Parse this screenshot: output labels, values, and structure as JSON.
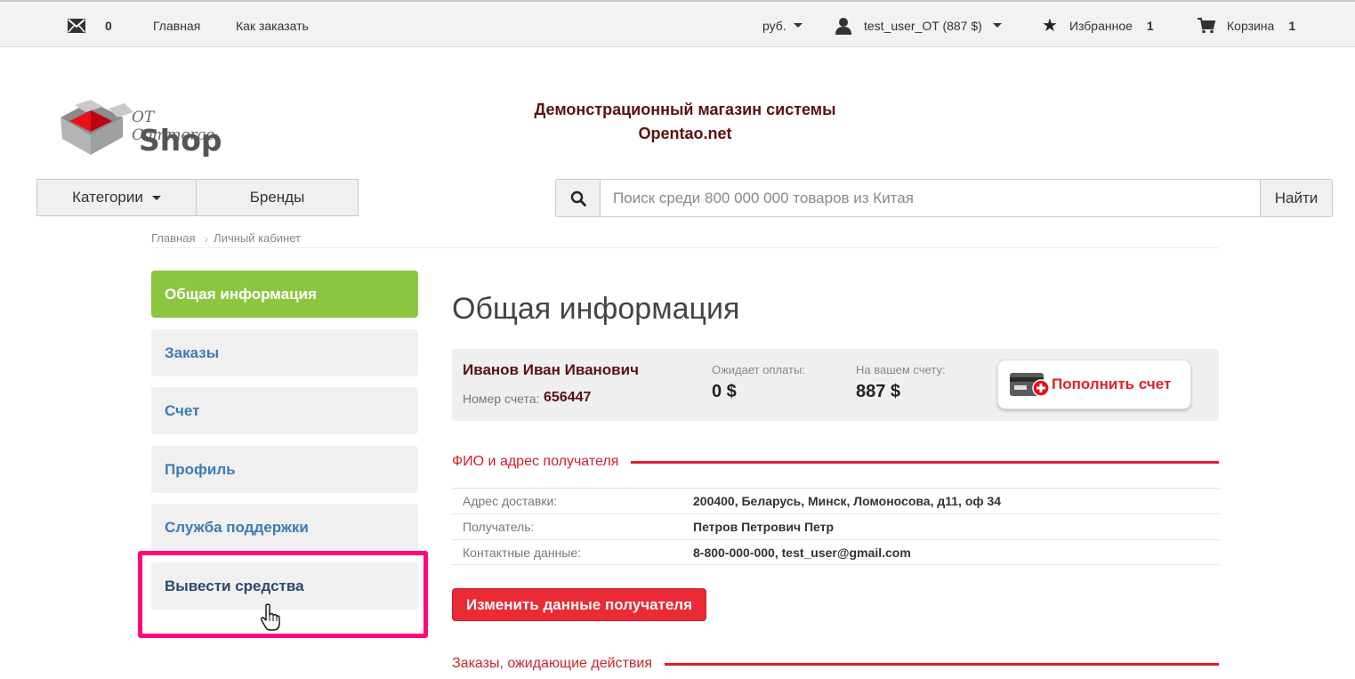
{
  "topbar": {
    "mail_icon": "envelope-icon",
    "mail_count": "0",
    "nav_home": "Главная",
    "nav_how_to_order": "Как заказать",
    "currency": "руб.",
    "user_icon": "user-icon",
    "user_label": "test_user_OT (887 $)",
    "favorites_icon": "star-icon",
    "favorites_label": "Избранное",
    "favorites_count": "1",
    "cart_icon": "cart-icon",
    "cart_label": "Корзина",
    "cart_count": "1"
  },
  "header": {
    "logo_text_top": "OT Commerce",
    "logo_text_main": "Shop",
    "title_line1": "Демонстрационный магазин системы",
    "title_line2": "Opentao.net"
  },
  "nav": {
    "categories_label": "Категории",
    "brands_label": "Бренды"
  },
  "search": {
    "icon": "search-icon",
    "placeholder": "Поиск среди 800 000 000 товаров из Китая",
    "value": "",
    "button_label": "Найти"
  },
  "breadcrumb": {
    "items": [
      "Главная",
      "Личный кабинет"
    ]
  },
  "sidebar": {
    "items": [
      {
        "label": "Общая информация",
        "active": true
      },
      {
        "label": "Заказы"
      },
      {
        "label": "Счет"
      },
      {
        "label": "Профиль"
      },
      {
        "label": "Служба поддержки"
      },
      {
        "label": "Вывести средства",
        "highlighted": true
      }
    ]
  },
  "main": {
    "title": "Общая информация",
    "account": {
      "name": "Иванов Иван Иванович",
      "account_label": "Номер счета:",
      "account_number": "656447",
      "pending_label": "Ожидает оплаты:",
      "pending_value": "0 $",
      "balance_label": "На вашем счету:",
      "balance_value": "887 $",
      "topup_label": "Пополнить счет",
      "topup_icon": "card-plus-icon"
    },
    "recipient_section": "ФИО и адрес получателя",
    "recipient_rows": [
      {
        "key": "Адрес доставки:",
        "value": "200400, Беларусь, Минск, Ломоносова, д11, оф 34"
      },
      {
        "key": "Получатель:",
        "value": "Петров Петрович Петр"
      },
      {
        "key": "Контактные данные:",
        "value": "8-800-000-000, test_user@gmail.com"
      }
    ],
    "edit_button": "Изменить данные получателя",
    "orders_section": "Заказы, ожидающие действия"
  },
  "colors": {
    "accent_green": "#8cc63f",
    "accent_red": "#e0202a",
    "highlight_pink": "#ff0a7c",
    "dark_red_text": "#5c1010",
    "link_blue": "#3d7ab8"
  }
}
